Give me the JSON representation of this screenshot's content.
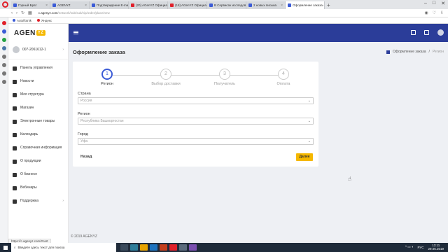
{
  "browser": {
    "tabs": [
      {
        "label": "Горный Брат",
        "color": "#3b5bd6",
        "active": false
      },
      {
        "label": "AGENYZ",
        "color": "#3b5bd6",
        "active": false
      },
      {
        "label": "Подтверждение E-mail",
        "color": "#3b5bd6",
        "active": false
      },
      {
        "label": "(20) AGenYZ Официальны",
        "color": "#e0202a",
        "active": false
      },
      {
        "label": "(18) AGenYZ Официальны",
        "color": "#e0202a",
        "active": false
      },
      {
        "label": "В Сервисах исследовар",
        "color": "#3b5bd6",
        "active": false
      },
      {
        "label": "2 новых письма",
        "color": "#3b5bd6",
        "active": false
      },
      {
        "label": "Оформление заказа - AGE",
        "color": "#3b5bd6",
        "active": true
      }
    ],
    "new_tab": "+",
    "url_host": "c.agenyz.com",
    "url_rest": "/network/sub/sub/vip/order/place/new",
    "bookmarks": [
      {
        "label": "Autoflotnik",
        "color": "#3b5bd6"
      },
      {
        "label": "Яндекс",
        "color": "#e0202a"
      }
    ]
  },
  "sidebar": {
    "logo_main": "AGEN",
    "logo_badge": "YZ",
    "user_id": "007-2061612-1",
    "items": [
      {
        "label": "Панель управления",
        "icon": "dashboard-icon",
        "chev": ""
      },
      {
        "label": "Новости",
        "icon": "news-icon",
        "chev": ""
      },
      {
        "label": "Моя структура",
        "icon": "structure-icon",
        "chev": ""
      },
      {
        "label": "Магазин",
        "icon": "shop-icon",
        "chev": ""
      },
      {
        "label": "Электронные товары",
        "icon": "download-icon",
        "chev": ""
      },
      {
        "label": "Календарь",
        "icon": "calendar-icon",
        "chev": ""
      },
      {
        "label": "Справочная информация",
        "icon": "info-icon",
        "chev": ""
      },
      {
        "label": "О продукции",
        "icon": "puzzle-icon",
        "chev": ""
      },
      {
        "label": "О бизнесе",
        "icon": "briefcase-icon",
        "chev": ""
      },
      {
        "label": "Вебинары",
        "icon": "webinar-icon",
        "chev": ""
      },
      {
        "label": "Поддержка",
        "icon": "support-icon",
        "chev": "›"
      }
    ]
  },
  "page": {
    "title": "Оформление заказа",
    "breadcrumb_parent": "Оформление заказа",
    "breadcrumb_current": "Регион",
    "steps": [
      {
        "num": "1",
        "label": "Регион",
        "active": true
      },
      {
        "num": "2",
        "label": "Выбор доставки",
        "active": false
      },
      {
        "num": "3",
        "label": "Получатель",
        "active": false
      },
      {
        "num": "4",
        "label": "Оплата",
        "active": false
      }
    ],
    "fields": [
      {
        "label": "Страна",
        "value": "Россия"
      },
      {
        "label": "Регион",
        "value": "Республика Башкортостан"
      },
      {
        "label": "Город",
        "value": "Уфа"
      }
    ],
    "back_label": "Назад",
    "next_label": "Далее"
  },
  "footer": "© 2019 AGENYZ",
  "status_url": "https://c.agenyz.com/#cart",
  "taskbar": {
    "search_placeholder": "Введите здесь текст для поиска",
    "lang": "РУС",
    "time": "13:11",
    "date": "29.05.2019"
  }
}
